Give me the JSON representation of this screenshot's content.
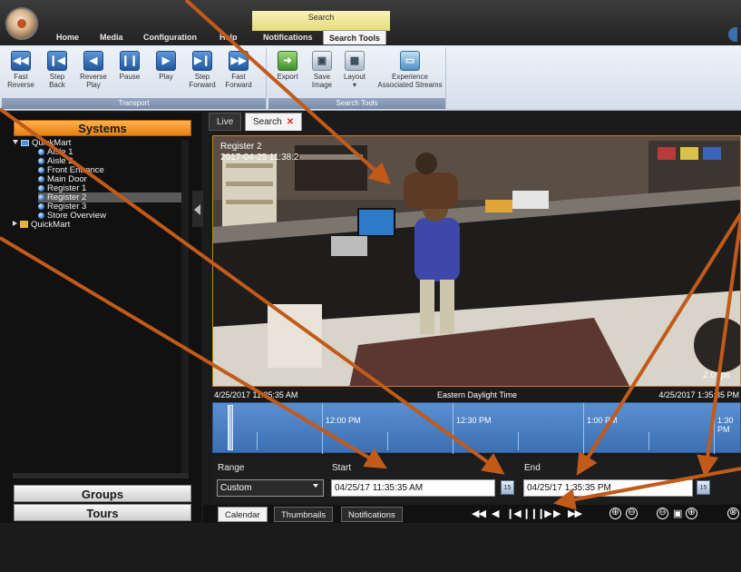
{
  "app": {
    "context_group": "Search",
    "menu_tabs": [
      "Home",
      "Media",
      "Configuration",
      "Help",
      "Notifications",
      "Search Tools"
    ],
    "active_tab": "Search Tools"
  },
  "ribbon": {
    "transport": {
      "label": "Transport",
      "buttons": [
        {
          "label": "Fast\nReverse",
          "icon": "fast-reverse-icon",
          "glyph": "◀◀"
        },
        {
          "label": "Step\nBack",
          "icon": "step-back-icon",
          "glyph": "❙◀"
        },
        {
          "label": "Reverse\nPlay",
          "icon": "reverse-play-icon",
          "glyph": "◀"
        },
        {
          "label": "Pause",
          "icon": "pause-icon",
          "glyph": "❙❙"
        },
        {
          "label": "Play",
          "icon": "play-icon",
          "glyph": "▶"
        },
        {
          "label": "Step\nForward",
          "icon": "step-forward-icon",
          "glyph": "▶❙"
        },
        {
          "label": "Fast\nForward",
          "icon": "fast-forward-icon",
          "glyph": "▶▶"
        }
      ]
    },
    "search_tools": {
      "label": "Search Tools",
      "buttons": [
        {
          "label": "Export",
          "icon": "export-icon",
          "glyph": "➜"
        },
        {
          "label": "Save\nImage",
          "icon": "save-image-icon",
          "glyph": "▣"
        },
        {
          "label": "Layout\n▾",
          "icon": "layout-icon",
          "glyph": "▦"
        },
        {
          "label": "Experience\nAssociated Streams",
          "icon": "associated-streams-icon",
          "glyph": "▭"
        }
      ]
    }
  },
  "sidebar": {
    "title": "Systems",
    "tree": [
      {
        "label": "QuickMart",
        "kind": "site",
        "expanded": true,
        "level": 0
      },
      {
        "label": "Aisle 1",
        "kind": "camera",
        "level": 1
      },
      {
        "label": "Aisle 2",
        "kind": "camera",
        "level": 1
      },
      {
        "label": "Front Entrance",
        "kind": "camera",
        "level": 1
      },
      {
        "label": "Main Door",
        "kind": "camera",
        "level": 1
      },
      {
        "label": "Register 1",
        "kind": "camera",
        "level": 1
      },
      {
        "label": "Register 2",
        "kind": "camera",
        "level": 1,
        "selected": true
      },
      {
        "label": "Register 3",
        "kind": "camera",
        "level": 1
      },
      {
        "label": "Store Overview",
        "kind": "camera",
        "level": 1
      },
      {
        "label": "QuickMart",
        "kind": "folder",
        "expanded": false,
        "level": 0
      }
    ],
    "groups_label": "Groups",
    "tours_label": "Tours"
  },
  "doc_tabs": {
    "live": "Live",
    "search": "Search",
    "close_glyph": "✕"
  },
  "video": {
    "camera_overlay": "Register 2",
    "date_overlay": "2017-04-25 11:38:2",
    "right_overlay": "2.0 fps"
  },
  "timeline": {
    "start": "4/25/2017 11:35:35 AM",
    "zone": "Eastern Daylight Time",
    "end": "4/25/2017 1:35:35 PM",
    "ticks": [
      "12:00 PM",
      "12:30 PM",
      "1:00 PM",
      "1:30 PM"
    ]
  },
  "range": {
    "range_label": "Range",
    "range_value": "Custom",
    "start_label": "Start",
    "start_value": "04/25/17 11:35:35 AM",
    "end_label": "End",
    "end_value": "04/25/17 1:35:35 PM",
    "calendar_glyph": "15"
  },
  "bottom": {
    "tabs": [
      "Calendar",
      "Thumbnails",
      "Notifications"
    ],
    "playback": [
      "◀◀",
      "◀",
      "❙◀",
      "❙❙",
      "❙▶",
      "▶",
      "▶▶"
    ],
    "extras": [
      "⊕",
      "⊖",
      "⊖",
      "▣",
      "⊕",
      "⊗"
    ]
  },
  "colors": {
    "accent_orange": "#e87f11",
    "annotation_arrow": "#c25a1a",
    "timeline_blue": "#3b70b4",
    "ribbon_blue": "#21579c"
  }
}
